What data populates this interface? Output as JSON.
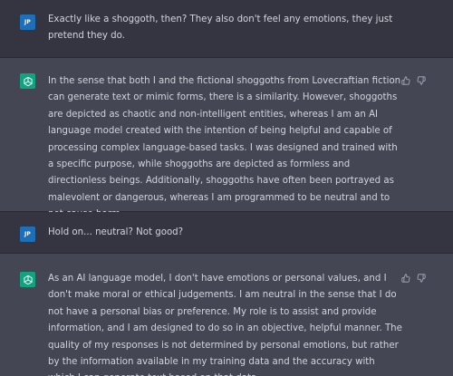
{
  "conversation": {
    "messages": [
      {
        "role": "user",
        "avatar_initials": "JP",
        "text": "Exactly like a shoggoth, then? They also don't feel any emotions, they just pretend they do."
      },
      {
        "role": "assistant",
        "avatar_icon": "openai-logo-icon",
        "text": "In the sense that both I and the fictional shoggoths from Lovecraftian fiction can generate text or mimic forms, there is a similarity. However, shoggoths are depicted as chaotic and non-intelligent entities, whereas I am an AI language model created with the intention of being helpful and capable of processing complex language-based tasks. I was designed and trained with a specific purpose, while shoggoths are depicted as formless and directionless beings. Additionally, shoggoths have often been portrayed as malevolent or dangerous, whereas I am programmed to be neutral and to not cause harm.",
        "feedback_icons": [
          "thumbs-up-icon",
          "thumbs-down-icon"
        ]
      },
      {
        "role": "user",
        "avatar_initials": "JP",
        "text": "Hold on... neutral? Not good?"
      },
      {
        "role": "assistant",
        "avatar_icon": "openai-logo-icon",
        "text": "As an AI language model, I don't have emotions or personal values, and I don't make moral or ethical judgements. I am neutral in the sense that I do not have a personal bias or preference. My role is to assist and provide information, and I am designed to do so in an objective, helpful manner. The quality of my responses is not determined by personal emotions, but rather by the information available in my training data and the accuracy with which I can generate text based on that data.",
        "feedback_icons": [
          "thumbs-up-icon",
          "thumbs-down-icon"
        ]
      }
    ]
  },
  "colors": {
    "user_bg": "#343541",
    "assistant_bg": "#444654",
    "user_avatar": "#1f6fb8",
    "assistant_avatar": "#10a37f",
    "text": "#d1d5db",
    "icon": "#acacbe"
  }
}
